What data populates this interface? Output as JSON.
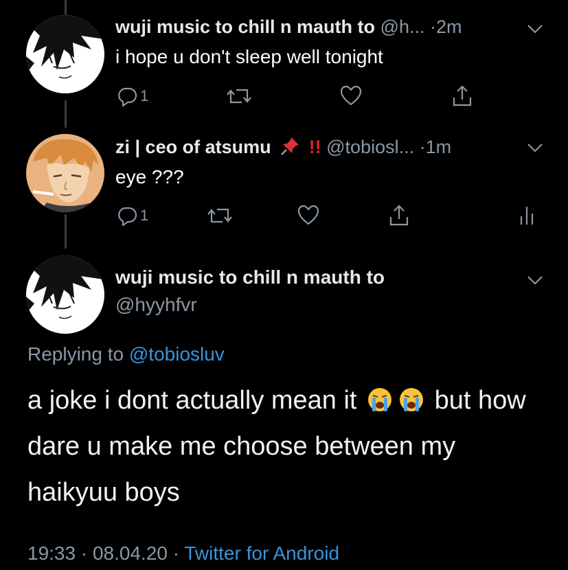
{
  "tweet1": {
    "author_name": "wuji music to chill n mauth to",
    "handle": "@h...",
    "separator": "·",
    "time": "2m",
    "text": "i hope u don't sleep well tonight",
    "reply_count": "1"
  },
  "tweet2": {
    "author_name": "zi | ceo of atsumu",
    "emoji_pin": "📌",
    "emoji_exclaim": "‼️",
    "handle": "@tobiosl...",
    "separator": "·",
    "time": "1m",
    "text": "eye ???",
    "reply_count": "1"
  },
  "main_tweet": {
    "author_name": "wuji music to chill n mauth to",
    "handle": "@hyyhfvr",
    "replying_prefix": "Replying to",
    "replying_to": "@tobiosluv",
    "text_part1": "a joke i dont actually mean it",
    "emoji": "😭",
    "text_part2": "but how dare u make me choose between my haikyuu boys",
    "time": "19:33",
    "separator1": "·",
    "date": "08.04.20",
    "separator2": "·",
    "source": "Twitter for Android"
  },
  "icons": {
    "reply": "reply-icon",
    "retweet": "retweet-icon",
    "like": "heart-icon",
    "share": "share-icon",
    "analytics": "analytics-icon",
    "menu": "chevron-down-icon"
  },
  "colors": {
    "background": "#000000",
    "link": "#3b94d9",
    "muted": "#8b98a5",
    "thread_line": "#3d3d3d"
  }
}
